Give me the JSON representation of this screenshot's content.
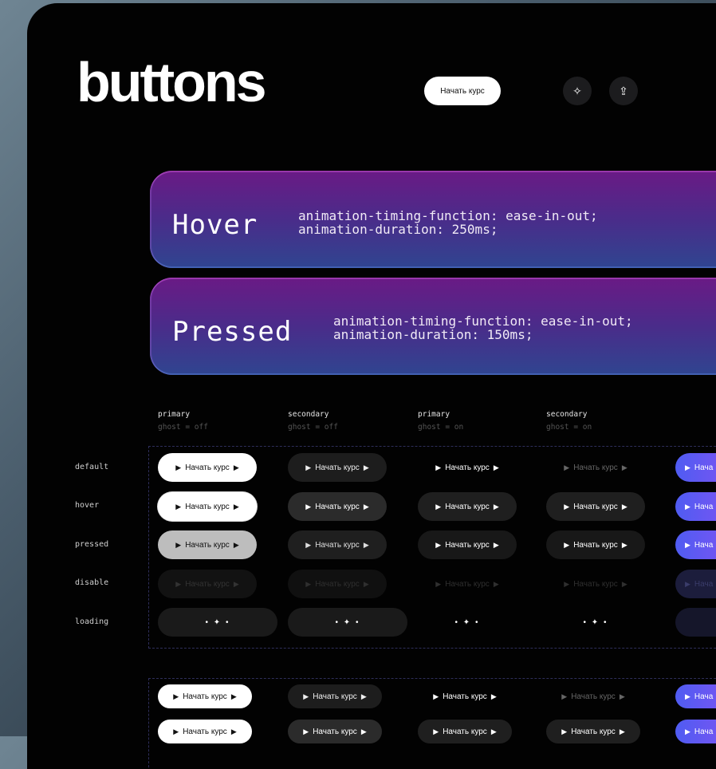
{
  "title": "buttons",
  "header": {
    "start_button": "Начать курс",
    "icon1": "sparkle-icon",
    "icon2": "share-icon"
  },
  "cards": [
    {
      "name": "Hover",
      "code_line1": "animation-timing-function: ease-in-out;",
      "code_line2": "animation-duration: 250ms;"
    },
    {
      "name": "Pressed",
      "code_line1": "animation-timing-function: ease-in-out;",
      "code_line2": "animation-duration: 150ms;"
    }
  ],
  "columns": [
    {
      "type": "primary",
      "ghost": "ghost = off"
    },
    {
      "type": "secondary",
      "ghost": "ghost = off"
    },
    {
      "type": "primary",
      "ghost": "ghost = on"
    },
    {
      "type": "secondary",
      "ghost": "ghost = on"
    }
  ],
  "rows": [
    "default",
    "hover",
    "pressed",
    "disable",
    "loading"
  ],
  "button_label": "Начать курс",
  "accent_label": "Нача",
  "loading_glyph": "• ✦ •",
  "colors": {
    "panel": "#020202",
    "accent_start": "#4f5cf2",
    "accent_end": "#7b54f2",
    "card_top": "#6a1a85",
    "card_bottom": "#2f4590"
  }
}
